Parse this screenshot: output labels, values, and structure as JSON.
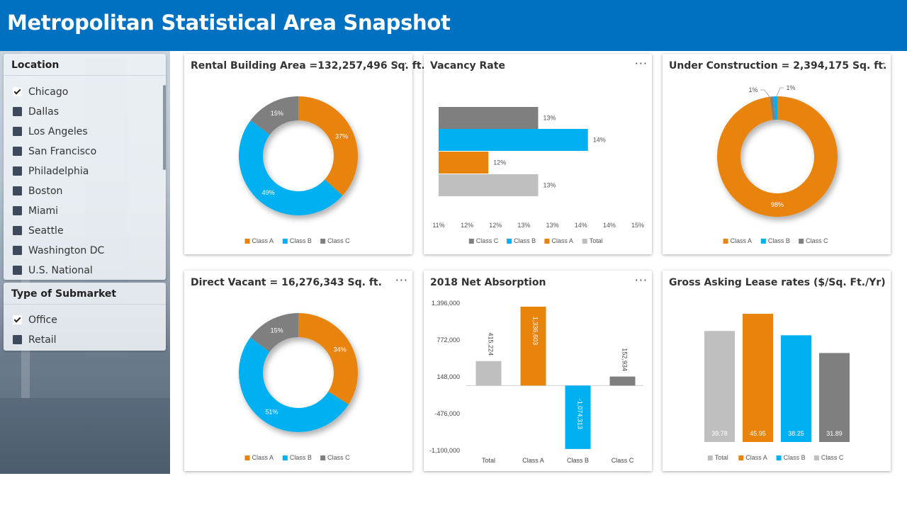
{
  "header": {
    "title": "Metropolitan Statistical Area Snapshot"
  },
  "location_slicer": {
    "title": "Location",
    "items": [
      {
        "label": "Chicago",
        "checked": true
      },
      {
        "label": "Dallas",
        "checked": false
      },
      {
        "label": "Los Angeles",
        "checked": false
      },
      {
        "label": "San Francisco",
        "checked": false
      },
      {
        "label": "Philadelphia",
        "checked": false
      },
      {
        "label": "Boston",
        "checked": false
      },
      {
        "label": "Miami",
        "checked": false
      },
      {
        "label": "Seattle",
        "checked": false
      },
      {
        "label": "Washington DC",
        "checked": false
      },
      {
        "label": "U.S. National",
        "checked": false
      }
    ]
  },
  "submarket_slicer": {
    "title": "Type of Submarket",
    "items": [
      {
        "label": "Office",
        "checked": true
      },
      {
        "label": "Retail",
        "checked": false
      }
    ]
  },
  "colors": {
    "class_a": "#e8830c",
    "class_b": "#00b0f0",
    "class_c": "#7f7f7f",
    "total": "#bfbfbf",
    "header": "#0070c0"
  },
  "cards": {
    "rental": {
      "title": "Rental Building Area =132,257,496 Sq. ft.",
      "more": "···"
    },
    "vacancy": {
      "title": "Vacancy Rate",
      "more": "···"
    },
    "construction": {
      "title": "Under Construction = 2,394,175 Sq. ft.",
      "more": "···"
    },
    "direct": {
      "title": "Direct Vacant = 16,276,343 Sq. ft.",
      "more": "···"
    },
    "absorption": {
      "title": "2018 Net Absorption",
      "more": "···"
    },
    "lease": {
      "title": "Gross Asking Lease rates ($/Sq. Ft./Yr)"
    }
  },
  "chart_data": [
    {
      "id": "rental",
      "type": "pie",
      "slices": [
        {
          "name": "Class A",
          "value": 37,
          "label": "37%",
          "color": "#e8830c"
        },
        {
          "name": "Class B",
          "value": 49,
          "label": "49%",
          "color": "#00b0f0"
        },
        {
          "name": "Class C",
          "value": 15,
          "label": "15%",
          "color": "#7f7f7f"
        }
      ],
      "legend": [
        {
          "name": "Class A",
          "color": "#e8830c"
        },
        {
          "name": "Class B",
          "color": "#00b0f0"
        },
        {
          "name": "Class C",
          "color": "#7f7f7f"
        }
      ]
    },
    {
      "id": "vacancy",
      "type": "bar",
      "bars": [
        {
          "name": "Class C",
          "value": 13,
          "label": "13%",
          "color": "#7f7f7f"
        },
        {
          "name": "Class B",
          "value": 14,
          "label": "14%",
          "color": "#00b0f0"
        },
        {
          "name": "Class A",
          "value": 12,
          "label": "12%",
          "color": "#e8830c"
        },
        {
          "name": "Total",
          "value": 13,
          "label": "13%",
          "color": "#bfbfbf"
        }
      ],
      "xlim": [
        11,
        15
      ],
      "xticks": [
        "11%",
        "12%",
        "12%",
        "13%",
        "13%",
        "14%",
        "14%",
        "15%"
      ],
      "legend": [
        {
          "name": "Class C",
          "color": "#7f7f7f"
        },
        {
          "name": "Class B",
          "color": "#00b0f0"
        },
        {
          "name": "Class A",
          "color": "#e8830c"
        },
        {
          "name": "Total",
          "color": "#bfbfbf"
        }
      ]
    },
    {
      "id": "construction",
      "type": "pie",
      "slices": [
        {
          "name": "Class A",
          "value": 98,
          "label": "98%",
          "color": "#e8830c"
        },
        {
          "name": "Class B",
          "value": 1,
          "label": "1%",
          "color": "#00b0f0"
        },
        {
          "name": "Class C",
          "value": 1,
          "label": "1%",
          "color": "#7f7f7f"
        }
      ],
      "legend": [
        {
          "name": "Class A",
          "color": "#e8830c"
        },
        {
          "name": "Class B",
          "color": "#00b0f0"
        },
        {
          "name": "Class C",
          "color": "#7f7f7f"
        }
      ]
    },
    {
      "id": "direct",
      "type": "pie",
      "slices": [
        {
          "name": "Class A",
          "value": 34,
          "label": "34%",
          "color": "#e8830c"
        },
        {
          "name": "Class B",
          "value": 51,
          "label": "51%",
          "color": "#00b0f0"
        },
        {
          "name": "Class C",
          "value": 15,
          "label": "15%",
          "color": "#7f7f7f"
        }
      ],
      "legend": [
        {
          "name": "Class A",
          "color": "#e8830c"
        },
        {
          "name": "Class B",
          "color": "#00b0f0"
        },
        {
          "name": "Class C",
          "color": "#7f7f7f"
        }
      ]
    },
    {
      "id": "absorption",
      "type": "bar",
      "categories": [
        "Total",
        "Class A",
        "Class B",
        "Class C"
      ],
      "values": [
        415224,
        1336603,
        -1074313,
        152934
      ],
      "labels": [
        "415,224",
        "1,336,603",
        "-1,074,313",
        "152,934"
      ],
      "colors": [
        "#bfbfbf",
        "#e8830c",
        "#00b0f0",
        "#7f7f7f"
      ],
      "ylim": [
        -1100000,
        1396000
      ],
      "yticks": [
        "1,396,000",
        "772,000",
        "148,000",
        "-476,000",
        "-1,100,000"
      ]
    },
    {
      "id": "lease",
      "type": "bar",
      "bars": [
        {
          "name": "Total",
          "value": 39.78,
          "label": "39.78",
          "color": "#bfbfbf"
        },
        {
          "name": "Class A",
          "value": 45.95,
          "label": "45.95",
          "color": "#e8830c"
        },
        {
          "name": "Class B",
          "value": 38.25,
          "label": "38.25",
          "color": "#00b0f0"
        },
        {
          "name": "Class C",
          "value": 31.89,
          "label": "31.89",
          "color": "#7f7f7f"
        }
      ],
      "legend": [
        {
          "name": "Total",
          "color": "#bfbfbf"
        },
        {
          "name": "Class A",
          "color": "#e8830c"
        },
        {
          "name": "Class B",
          "color": "#00b0f0"
        },
        {
          "name": "Class C",
          "color": "#bfbfbf"
        }
      ]
    }
  ]
}
